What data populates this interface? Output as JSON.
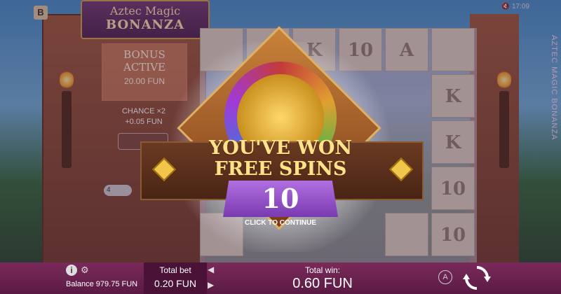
{
  "game": {
    "logo_line1": "Aztec Magic",
    "logo_line2": "BONANZA",
    "side_title": "AZTEC MAGIC BONANZA",
    "b_button": "B",
    "clock": "17:09"
  },
  "left_panel": {
    "bonus_title_1": "BONUS",
    "bonus_title_2": "ACTIVE",
    "bonus_price": "20.00 FUN",
    "chance_1": "CHANCE ×2",
    "chance_2": "+0.05 FUN",
    "ante_value": "4"
  },
  "reels": [
    [
      "",
      "A",
      ""
    ],
    [
      "",
      "K",
      ""
    ],
    [
      "K",
      "K",
      ""
    ],
    [
      "10",
      "10",
      ""
    ],
    [
      "10",
      "",
      ""
    ]
  ],
  "popup": {
    "line1": "YOU'VE WON",
    "line2": "FREE SPINS",
    "count": "10",
    "continue": "CLICK TO CONTINUE"
  },
  "bottom_bar": {
    "balance": "Balance 979.75 FUN",
    "total_bet_label": "Total bet",
    "total_bet_value": "0.20 FUN",
    "total_win_label": "Total win:",
    "total_win_value": "0.60 FUN",
    "auto_label": "A"
  },
  "colors": {
    "bar": "#6a2050",
    "banner_text": "#ffe38a",
    "count_box": "#9a55d0"
  }
}
